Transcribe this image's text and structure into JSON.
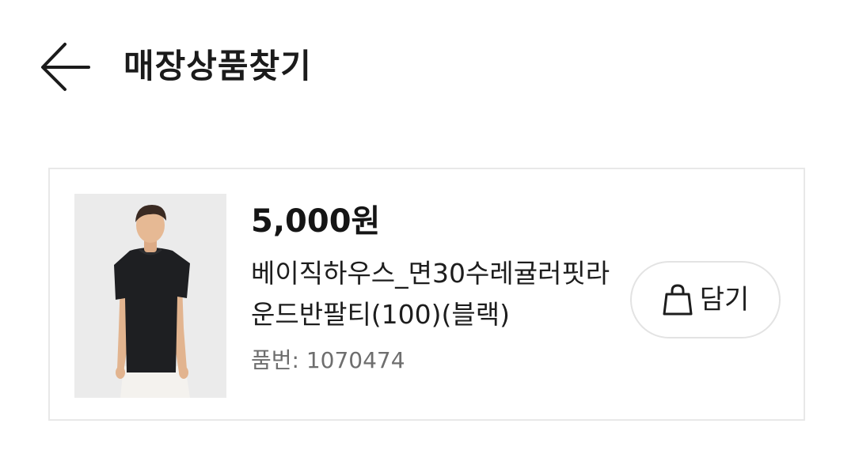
{
  "header": {
    "back_icon": "arrow-left-icon",
    "title": "매장상품찾기"
  },
  "product": {
    "image": "product-photo",
    "price": "5,000원",
    "name": "베이직하우스_면30수레귤러핏라운드반팔티(100)(블랙)",
    "item_code": "품번: 1070474",
    "add_button": {
      "icon": "shopping-bag-icon",
      "label": "담기"
    }
  }
}
